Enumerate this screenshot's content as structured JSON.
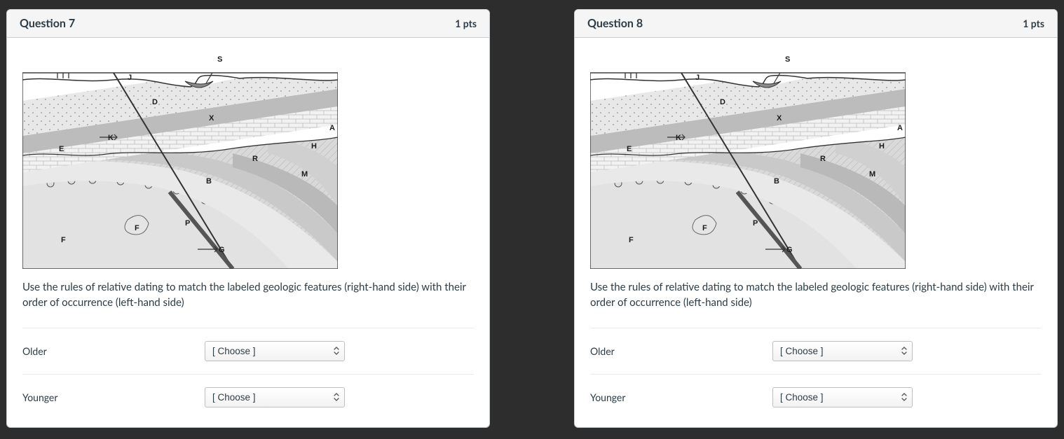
{
  "questions": [
    {
      "title": "Question 7",
      "points": "1 pts",
      "instructions": "Use the rules of relative dating to match the labeled geologic features (right-hand side) with their order of occurrence (left-hand side)",
      "diagram_labels": [
        "S",
        "J",
        "D",
        "X",
        "A",
        "K",
        "E",
        "H",
        "R",
        "M",
        "B",
        "P",
        "F",
        "G",
        "F"
      ],
      "rows": [
        {
          "label": "Older",
          "placeholder": "[ Choose ]"
        },
        {
          "label": "Younger",
          "placeholder": "[ Choose ]"
        }
      ]
    },
    {
      "title": "Question 8",
      "points": "1 pts",
      "instructions": "Use the rules of relative dating to match the labeled geologic features (right-hand side) with their order of occurrence (left-hand side)",
      "diagram_labels": [
        "S",
        "J",
        "D",
        "X",
        "A",
        "K",
        "E",
        "H",
        "R",
        "M",
        "B",
        "P",
        "F",
        "G",
        "F"
      ],
      "rows": [
        {
          "label": "Older",
          "placeholder": "[ Choose ]"
        },
        {
          "label": "Younger",
          "placeholder": "[ Choose ]"
        }
      ]
    }
  ]
}
